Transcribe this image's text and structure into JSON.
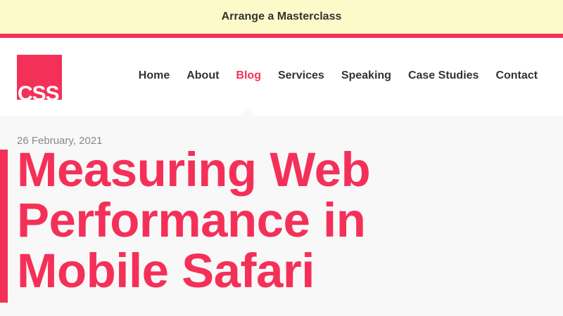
{
  "promo": {
    "label": "Arrange a Masterclass"
  },
  "logo": {
    "text": "CSS"
  },
  "nav": {
    "items": [
      {
        "label": "Home"
      },
      {
        "label": "About"
      },
      {
        "label": "Blog",
        "active": true
      },
      {
        "label": "Services"
      },
      {
        "label": "Speaking"
      },
      {
        "label": "Case Studies"
      },
      {
        "label": "Contact"
      }
    ]
  },
  "article": {
    "date": "26 February, 2021",
    "title": "Measuring Web Performance in Mobile Safari"
  },
  "colors": {
    "accent": "#f43059",
    "promo_bg": "#fdfac9",
    "page_bg": "#f8f8f8"
  }
}
